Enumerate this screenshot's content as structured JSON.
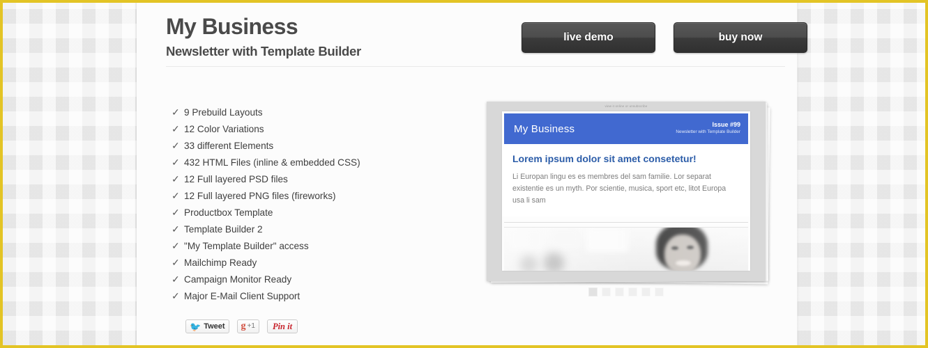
{
  "header": {
    "title": "My Business",
    "subtitle": "Newsletter with Template Builder"
  },
  "actions": {
    "live_demo": "live demo",
    "buy_now": "buy now"
  },
  "features": {
    "check_glyph": "✓",
    "items": [
      "9 Prebuild Layouts",
      "12 Color Variations",
      "33 different Elements",
      "432 HTML Files (inline & embedded CSS)",
      "12 Full layered PSD files",
      "12 Full layered PNG files (fireworks)",
      "Productbox Template",
      "Template Builder 2",
      "\"My Template Builder\" access",
      "Mailchimp Ready",
      "Campaign Monitor Ready",
      "Major E-Mail Client Support"
    ]
  },
  "social": {
    "tweet_label": "Tweet",
    "tweet_icon": "twitter-bird-icon",
    "gplus_g": "g",
    "gplus_count": "+1",
    "pinit_label": "Pin it"
  },
  "preview": {
    "view_online": "view it online or unsubscribe",
    "brand": "My Business",
    "issue": "Issue #99",
    "issue_subtitle": "Newsletter with Template Builder",
    "headline": "Lorem ipsum dolor sit amet consetetur!",
    "body": "Li Europan lingu es es membres del sam familie. Lor separat existentie es un myth. Por scientie, musica, sport etc, litot Europa usa li sam",
    "dots": [
      "1",
      "2",
      "3",
      "4",
      "5",
      "6"
    ],
    "active_dot": 0
  },
  "colors": {
    "frame": "#e3c425",
    "newsletter_blue": "#4169d0",
    "headline_blue": "#2b5ca8",
    "button_dark": "#3b3b3b",
    "pinterest_red": "#c8232c",
    "twitter_blue": "#3aa9e0",
    "gplus_red": "#d24b3b"
  }
}
